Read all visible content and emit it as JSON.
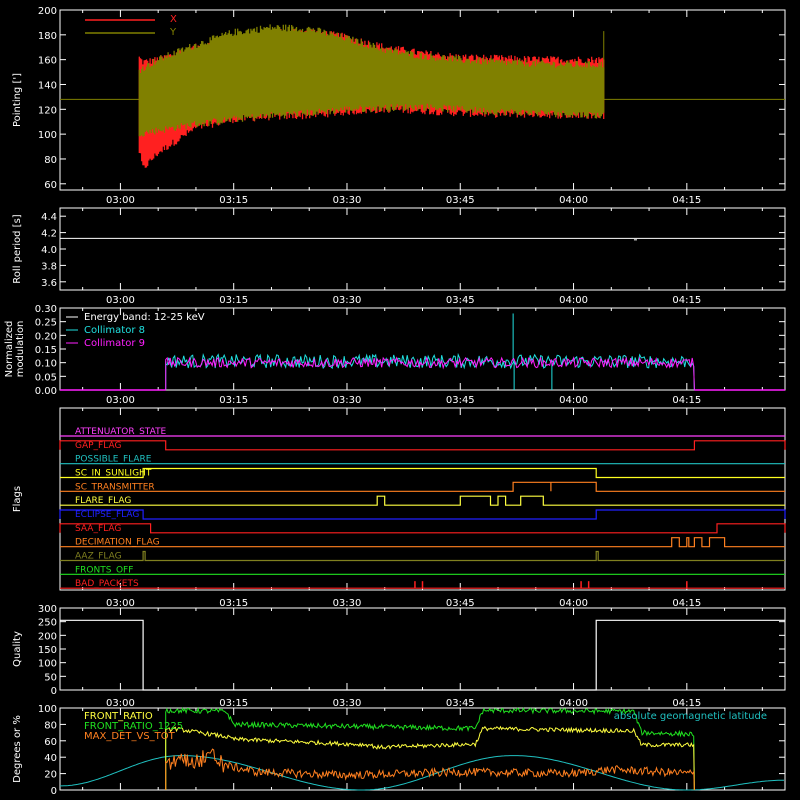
{
  "colors": {
    "background": "#000000",
    "axis": "#ffffff",
    "x": "#ff2020",
    "y": "#808000",
    "roll": "#ffffff",
    "collimator8": "#20e0e0",
    "collimator9": "#ff20ff",
    "front_ratio": "#ffff40",
    "front_ratio_1225": "#20e020",
    "max_det": "#ff8020",
    "latitude": "#20c0c0"
  },
  "chart_data": [
    {
      "id": "pointing",
      "type": "line",
      "ylabel": "Pointing [']",
      "ylim": [
        55,
        200
      ],
      "yticks": [
        "60",
        "80",
        "100",
        "120",
        "140",
        "160",
        "180",
        "200"
      ],
      "xtick_labels": [
        "03:00",
        "03:15",
        "03:30",
        "03:45",
        "04:00",
        "04:15"
      ],
      "legend": [
        "X",
        "Y"
      ],
      "baseline": 128,
      "data_span": [
        "03:02",
        "04:04"
      ],
      "x_envelope": {
        "t": [
          "03:02",
          "03:03",
          "03:05",
          "03:10",
          "03:15",
          "03:20",
          "03:25",
          "03:30",
          "03:35",
          "03:40",
          "03:45",
          "03:50",
          "03:55",
          "04:00",
          "04:04"
        ],
        "upper": [
          165,
          158,
          160,
          170,
          176,
          182,
          183,
          178,
          170,
          165,
          162,
          161,
          160,
          160,
          160
        ],
        "lower": [
          100,
          72,
          85,
          105,
          112,
          114,
          115,
          118,
          120,
          119,
          117,
          116,
          116,
          115,
          115
        ]
      },
      "y_envelope": {
        "t": [
          "03:02",
          "03:05",
          "03:10",
          "03:15",
          "03:20",
          "03:25",
          "03:30",
          "03:35",
          "03:40",
          "03:45",
          "03:50",
          "03:55",
          "04:00",
          "04:04"
        ],
        "upper": [
          150,
          160,
          172,
          182,
          186,
          185,
          177,
          168,
          163,
          160,
          158,
          157,
          156,
          156
        ],
        "lower": [
          100,
          103,
          108,
          112,
          115,
          117,
          120,
          121,
          122,
          120,
          118,
          117,
          116,
          115
        ]
      }
    },
    {
      "id": "roll",
      "type": "line",
      "ylabel": "Roll period [s]",
      "ylim": [
        3.5,
        4.5
      ],
      "yticks": [
        "3.6",
        "3.8",
        "4.0",
        "4.2",
        "4.4"
      ],
      "xtick_labels": [
        "03:00",
        "03:15",
        "03:30",
        "03:45",
        "04:00",
        "04:15"
      ],
      "value": 4.13
    },
    {
      "id": "modulation",
      "type": "line",
      "ylabel": "Normalized modulation",
      "ylim": [
        0,
        0.3
      ],
      "yticks": [
        "0.00",
        "0.05",
        "0.10",
        "0.15",
        "0.20",
        "0.25",
        "0.30"
      ],
      "xtick_labels": [
        "03:00",
        "03:15",
        "03:30",
        "03:45",
        "04:00",
        "04:15"
      ],
      "legend": [
        "Energy band: 12-25 keV",
        "Collimator 8",
        "Collimator 9"
      ],
      "data_span": [
        "03:06",
        "04:16"
      ],
      "series": [
        {
          "name": "Collimator 8",
          "mean": 0.105,
          "spread": 0.025,
          "spike_at": "03:52",
          "spike_value": 0.28,
          "dips_at": [
            "03:52",
            "03:57"
          ]
        },
        {
          "name": "Collimator 9",
          "mean": 0.1,
          "spread": 0.018
        }
      ]
    },
    {
      "id": "flags",
      "type": "line",
      "ylabel": "Flags",
      "xtick_labels": [
        "03:00",
        "03:15",
        "03:30",
        "03:45",
        "04:00",
        "04:15"
      ],
      "flags": [
        {
          "name": "ATTENUATOR_STATE",
          "color": "#ff40ff",
          "segments": []
        },
        {
          "name": "GAP_FLAG",
          "color": "#ff2020",
          "segments": [
            [
              "02:52",
              "03:06"
            ],
            [
              "04:16",
              "04:28"
            ]
          ]
        },
        {
          "name": "POSSIBLE_FLARE",
          "color": "#20c0c0",
          "segments": []
        },
        {
          "name": "SC_IN_SUNLIGHT",
          "color": "#ffff20",
          "segments": [
            [
              "03:03",
              "04:03"
            ]
          ]
        },
        {
          "name": "SC_TRANSMITTER",
          "color": "#ff8020",
          "segments": [
            [
              "03:52",
              "03:57"
            ],
            [
              "03:57",
              "04:03"
            ]
          ]
        },
        {
          "name": "FLARE_FLAG",
          "color": "#ffff40",
          "segments": [
            [
              "03:34",
              "03:35"
            ],
            [
              "03:45",
              "03:49"
            ],
            [
              "03:50",
              "03:51"
            ],
            [
              "03:53",
              "03:56"
            ]
          ]
        },
        {
          "name": "ECLIPSE_FLAG",
          "color": "#2020ff",
          "segments": [
            [
              "02:52",
              "03:03"
            ],
            [
              "04:03",
              "04:28"
            ]
          ]
        },
        {
          "name": "SAA_FLAG",
          "color": "#ff2020",
          "segments": [
            [
              "02:52",
              "03:04"
            ],
            [
              "04:19",
              "04:28"
            ]
          ]
        },
        {
          "name": "DECIMATION_FLAG",
          "color": "#ff8020",
          "segments": [
            [
              "04:13",
              "04:14"
            ],
            [
              "04:15",
              "04:15"
            ],
            [
              "04:16",
              "04:17"
            ],
            [
              "04:18",
              "04:20"
            ]
          ]
        },
        {
          "name": "AAZ_FLAG",
          "color": "#808020",
          "segments": [
            [
              "03:03",
              "03:03"
            ],
            [
              "04:03",
              "04:03"
            ]
          ]
        },
        {
          "name": "FRONTS_OFF",
          "color": "#20e020",
          "segments": []
        },
        {
          "name": "BAD_PACKETS",
          "color": "#ff2020",
          "segments": [],
          "ticks": [
            "03:39",
            "03:40",
            "04:01",
            "04:02",
            "04:15"
          ]
        }
      ]
    },
    {
      "id": "quality",
      "type": "line",
      "ylabel": "Quality",
      "ylim": [
        0,
        300
      ],
      "yticks": [
        "0",
        "50",
        "100",
        "150",
        "200",
        "250",
        "300"
      ],
      "xtick_labels": [
        "03:00",
        "03:15",
        "03:30",
        "03:45",
        "04:00",
        "04:15"
      ],
      "t": [
        "02:52",
        "03:03",
        "03:03",
        "04:03",
        "04:03",
        "04:28"
      ],
      "values": [
        255,
        255,
        0,
        0,
        255,
        255
      ]
    },
    {
      "id": "ratios",
      "type": "line",
      "ylabel": "Degrees or %",
      "ylim": [
        0,
        100
      ],
      "yticks": [
        "0",
        "20",
        "40",
        "60",
        "80",
        "100"
      ],
      "xtick_labels": [
        "03:00",
        "03:15",
        "03:30",
        "03:45",
        "04:00",
        "04:15"
      ],
      "legend": [
        "FRONT_RATIO",
        "FRONT_RATIO_1225",
        "MAX_DET_VS_TOT"
      ],
      "latitude_label": "absolute geomagnetic latitude",
      "data_span": [
        "03:06",
        "04:16"
      ],
      "series": [
        {
          "name": "FRONT_RATIO",
          "t": [
            "03:06",
            "03:07",
            "03:14",
            "03:15",
            "03:33",
            "03:34",
            "03:47",
            "03:48",
            "04:08",
            "04:09",
            "04:16"
          ],
          "values": [
            72,
            75,
            65,
            62,
            55,
            52,
            56,
            75,
            72,
            55,
            55
          ]
        },
        {
          "name": "FRONT_RATIO_1225",
          "t": [
            "03:06",
            "03:14",
            "03:15",
            "03:47",
            "03:48",
            "04:08",
            "04:09",
            "04:16"
          ],
          "values": [
            97,
            96,
            80,
            75,
            97,
            96,
            70,
            68
          ]
        },
        {
          "name": "MAX_DET_VS_TOT",
          "t": [
            "03:06",
            "03:08",
            "03:10",
            "03:12",
            "03:14",
            "03:18",
            "03:30",
            "03:45",
            "04:00",
            "04:05",
            "04:16"
          ],
          "values": [
            30,
            40,
            35,
            42,
            30,
            22,
            18,
            22,
            20,
            25,
            20
          ]
        }
      ],
      "latitude": {
        "t": [
          "02:52",
          "03:08",
          "03:32",
          "03:52",
          "04:15",
          "04:28"
        ],
        "values": [
          5,
          42,
          0,
          42,
          0,
          12
        ]
      }
    }
  ]
}
